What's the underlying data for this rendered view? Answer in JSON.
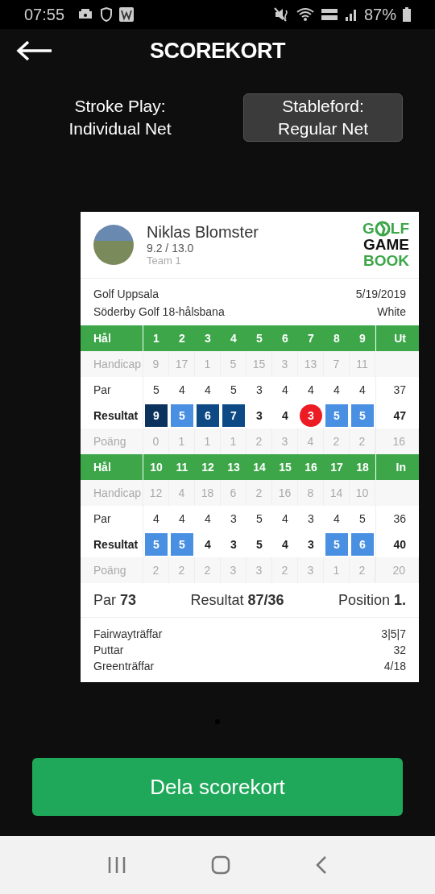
{
  "status_bar": {
    "time": "07:55",
    "battery": "87%"
  },
  "header": {
    "title": "SCOREKORT"
  },
  "tabs": [
    {
      "lines": [
        "Stroke Play:",
        "Individual Net"
      ],
      "selected": false
    },
    {
      "lines": [
        "Stableford:",
        "Regular Net"
      ],
      "selected": true
    }
  ],
  "card": {
    "player": {
      "name": "Niklas Blomster",
      "handicap": "9.2 / 13.0",
      "team": "Team 1"
    },
    "logo": {
      "first_letter": "G",
      "rest": "LF",
      "line2": "GAME",
      "line3": "BOOK"
    },
    "course": {
      "club": "Golf Uppsala",
      "date": "5/19/2019",
      "course": "Söderby Golf 18-hålsbana",
      "tee": "White"
    },
    "nines": [
      {
        "rows": [
          {
            "kind": "header",
            "label": "Hål",
            "values": [
              "1",
              "2",
              "3",
              "4",
              "5",
              "6",
              "7",
              "8",
              "9"
            ],
            "total": "Ut"
          },
          {
            "kind": "index",
            "label": "Handicap",
            "values": [
              "9",
              "17",
              "1",
              "5",
              "15",
              "3",
              "13",
              "7",
              "11"
            ]
          },
          {
            "kind": "par",
            "label": "Par",
            "values": [
              "5",
              "4",
              "4",
              "5",
              "3",
              "4",
              "4",
              "4",
              "4"
            ],
            "total": "37"
          },
          {
            "kind": "result",
            "label": "Resultat",
            "values": [
              {
                "value": "9",
                "kind": "worse"
              },
              {
                "value": "5",
                "kind": "bogey"
              },
              {
                "value": "6",
                "kind": "double"
              },
              {
                "value": "7",
                "kind": "double"
              },
              {
                "value": "3",
                "kind": "par"
              },
              {
                "value": "4",
                "kind": "par"
              },
              {
                "value": "3",
                "kind": "birdie"
              },
              {
                "value": "5",
                "kind": "bogey"
              },
              {
                "value": "5",
                "kind": "bogey"
              }
            ],
            "total": "47"
          },
          {
            "kind": "points",
            "label": "Poäng",
            "values": [
              "0",
              "1",
              "1",
              "1",
              "2",
              "3",
              "4",
              "2",
              "2"
            ],
            "total": "16"
          }
        ]
      },
      {
        "rows": [
          {
            "kind": "header",
            "label": "Hål",
            "values": [
              "10",
              "11",
              "12",
              "13",
              "14",
              "15",
              "16",
              "17",
              "18"
            ],
            "total": "In"
          },
          {
            "kind": "index",
            "label": "Handicap",
            "values": [
              "12",
              "4",
              "18",
              "6",
              "2",
              "16",
              "8",
              "14",
              "10"
            ]
          },
          {
            "kind": "par",
            "label": "Par",
            "values": [
              "4",
              "4",
              "4",
              "3",
              "5",
              "4",
              "3",
              "4",
              "5"
            ],
            "total": "36"
          },
          {
            "kind": "result",
            "label": "Resultat",
            "values": [
              {
                "value": "5",
                "kind": "bogey"
              },
              {
                "value": "5",
                "kind": "bogey"
              },
              {
                "value": "4",
                "kind": "par"
              },
              {
                "value": "3",
                "kind": "par"
              },
              {
                "value": "5",
                "kind": "par"
              },
              {
                "value": "4",
                "kind": "par"
              },
              {
                "value": "3",
                "kind": "par"
              },
              {
                "value": "5",
                "kind": "bogey"
              },
              {
                "value": "6",
                "kind": "bogey"
              }
            ],
            "total": "40"
          },
          {
            "kind": "points",
            "label": "Poäng",
            "values": [
              "2",
              "2",
              "2",
              "3",
              "3",
              "2",
              "3",
              "1",
              "2"
            ],
            "total": "20"
          }
        ]
      }
    ],
    "summary": [
      "Par **73**",
      "Resultat **87/36**",
      "Position **1.**"
    ],
    "stats": [
      {
        "label": "Fairwayträffar",
        "value": "3|5|7"
      },
      {
        "label": "Puttar",
        "value": "32"
      },
      {
        "label": "Greenträffar",
        "value": "4/18"
      }
    ]
  },
  "share_button": "Dela scorekort"
}
